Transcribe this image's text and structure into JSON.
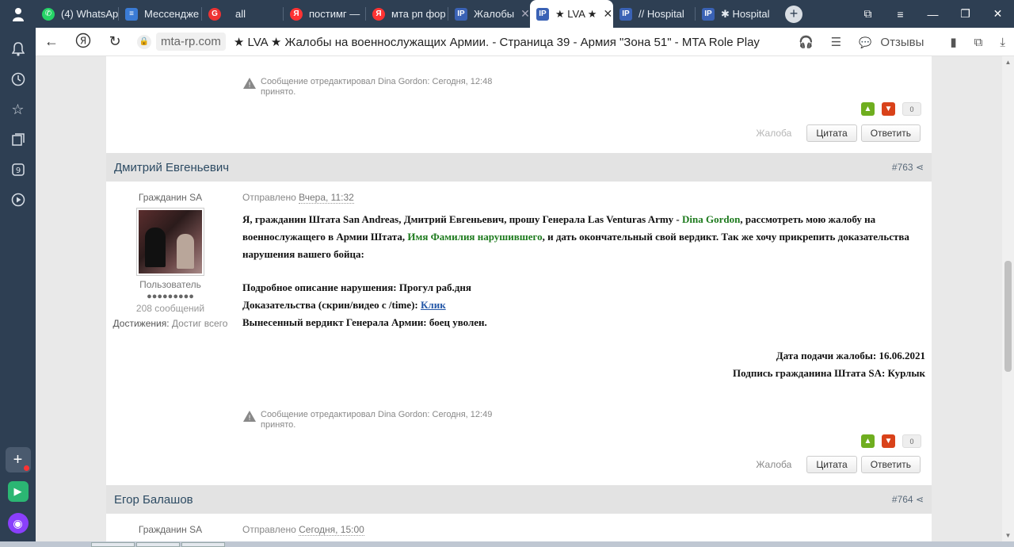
{
  "browser": {
    "tabs": [
      {
        "label": "(4) WhatsAp",
        "color": "#25d366"
      },
      {
        "label": "Мессендже",
        "color": "#3a7bd5"
      },
      {
        "label": "all",
        "color": "#e33"
      },
      {
        "label": "постимг —",
        "color": "#f33"
      },
      {
        "label": "мта рп фор",
        "color": "#f33"
      },
      {
        "label": "Жалобы",
        "color": "#3a62b5"
      },
      {
        "label": "★ LVA ★",
        "color": "#3a62b5"
      },
      {
        "label": "// Hospital",
        "color": "#3a62b5"
      },
      {
        "label": "✱ Hospital",
        "color": "#3a62b5"
      }
    ],
    "domain": "mta-rp.com",
    "page_title": "★ LVA ★ Жалобы на военнослужащих Армии. - Страница 39 - Армия \"Зона 51\" - MTA Role Play",
    "reviews": "Отзывы"
  },
  "prev_post": {
    "edit_note": "Сообщение отредактировал Dina Gordon: Сегодня, 12:48",
    "edit_status": "принято.",
    "votes": "0",
    "report": "Жалоба",
    "quote": "Цитата",
    "reply": "Ответить"
  },
  "post": {
    "author": "Дмитрий Евгеньевич",
    "number": "#763",
    "group": "Гражданин SA",
    "role": "Пользователь",
    "rating_dots": "●●●●●●●●●",
    "messages": "208 сообщений",
    "achievements_label": "Достижения:",
    "achievements_value": "Достиг всего",
    "sent_label": "Отправлено",
    "sent_date": "Вчера, 11:32",
    "p1_a": "Я, гражданин Штата San Andreas, Дмитрий Евгеньевич, прошу Генерала Las Venturas Army - ",
    "p1_general": "Dina Gordon",
    "p1_b": ", рассмотреть мою жалобу на военнослужащего в Армии Штата, ",
    "p1_name": "Имя Фамилия нарушившего",
    "p1_c": ", и дать окончательный свой вердикт. Так же хочу прикрепить доказательства нарушения вашего бойца:",
    "desc": "Подробное описание нарушения: Прогул раб.дня",
    "proof_label": "Доказательства (скрин/видео с /time):",
    "proof_link": "Клик",
    "verdict": "Вынесенный вердикт Генерала Армии: боец уволен.",
    "date_line": "Дата подачи жалобы: 16.06.2021",
    "sign_line": "Подпись гражданина Штата SA: Курлык",
    "edit_note": "Сообщение отредактировал Dina Gordon: Сегодня, 12:49",
    "edit_status": "принято.",
    "votes": "0",
    "report": "Жалоба",
    "quote": "Цитата",
    "reply": "Ответить"
  },
  "next_post": {
    "author": "Егор Балашов",
    "number": "#764",
    "group": "Гражданин SA",
    "sent_label": "Отправлено",
    "sent_date": "Сегодня, 15:00"
  }
}
